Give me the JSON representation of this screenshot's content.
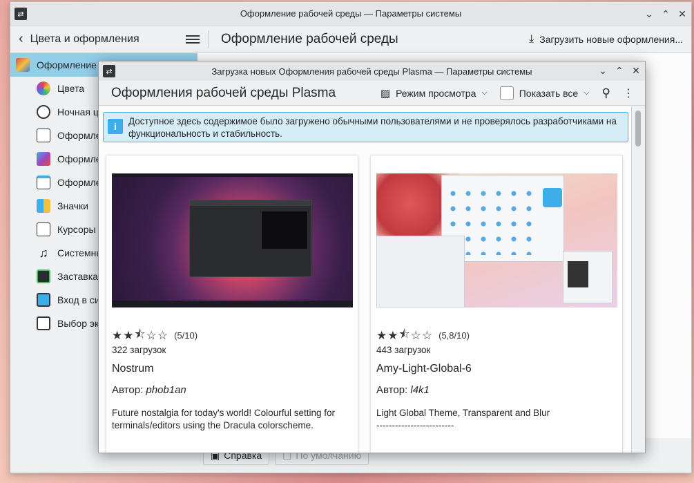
{
  "main_window": {
    "title": "Оформление рабочей среды — Параметры системы",
    "back_label": "Цвета и оформления",
    "page_title": "Оформление рабочей среды",
    "download_button": "Загрузить новые оформления...",
    "sidebar": {
      "selected": "Оформление р",
      "items": [
        {
          "label": "Цвета",
          "icon": "colors-icon"
        },
        {
          "label": "Ночная ц",
          "icon": "night-color-icon"
        },
        {
          "label": "Оформле",
          "icon": "app-style-icon"
        },
        {
          "label": "Оформле",
          "icon": "plasma-style-icon"
        },
        {
          "label": "Оформле",
          "icon": "window-decoration-icon"
        },
        {
          "label": "Значки",
          "icon": "icons-icon"
        },
        {
          "label": "Курсоры м",
          "icon": "cursors-icon"
        },
        {
          "label": "Системны",
          "icon": "system-sounds-icon"
        },
        {
          "label": "Заставка",
          "icon": "splash-screen-icon"
        },
        {
          "label": "Вход в си",
          "icon": "login-screen-icon"
        },
        {
          "label": "Выбор экр",
          "icon": "screen-locking-icon"
        }
      ]
    },
    "footer": {
      "help": "Справка",
      "defaults": "По умолчанию"
    }
  },
  "dialog": {
    "title": "Загрузка новых Оформления рабочей среды Plasma — Параметры системы",
    "heading": "Оформления рабочей среды Plasma",
    "view_mode": "Режим просмотра",
    "show_all": "Показать все",
    "info_text": "Доступное здесь содержимое было загружено обычными пользователями и не проверялось разработчиками на функциональность и стабильность.",
    "cards": [
      {
        "rating": "(5/10)",
        "rating_value": 5,
        "downloads": "322 загрузок",
        "name": "Nostrum",
        "author_prefix": "Автор: ",
        "author": "phob1an",
        "description": "Future nostalgia for today's world! Colourful setting for terminals/editors using the Dracula colorscheme."
      },
      {
        "rating": "(5,8/10)",
        "rating_value": 5.8,
        "downloads": "443 загрузок",
        "name": "Amy-Light-Global-6",
        "author_prefix": "Автор: ",
        "author": "l4k1",
        "description": "Light Global Theme, Transparent and Blur",
        "description_line2": "-------------------------"
      }
    ]
  },
  "colors": {
    "accent": "#3daee9",
    "selection": "#93cee9",
    "info_bg": "#d6ecf7"
  }
}
